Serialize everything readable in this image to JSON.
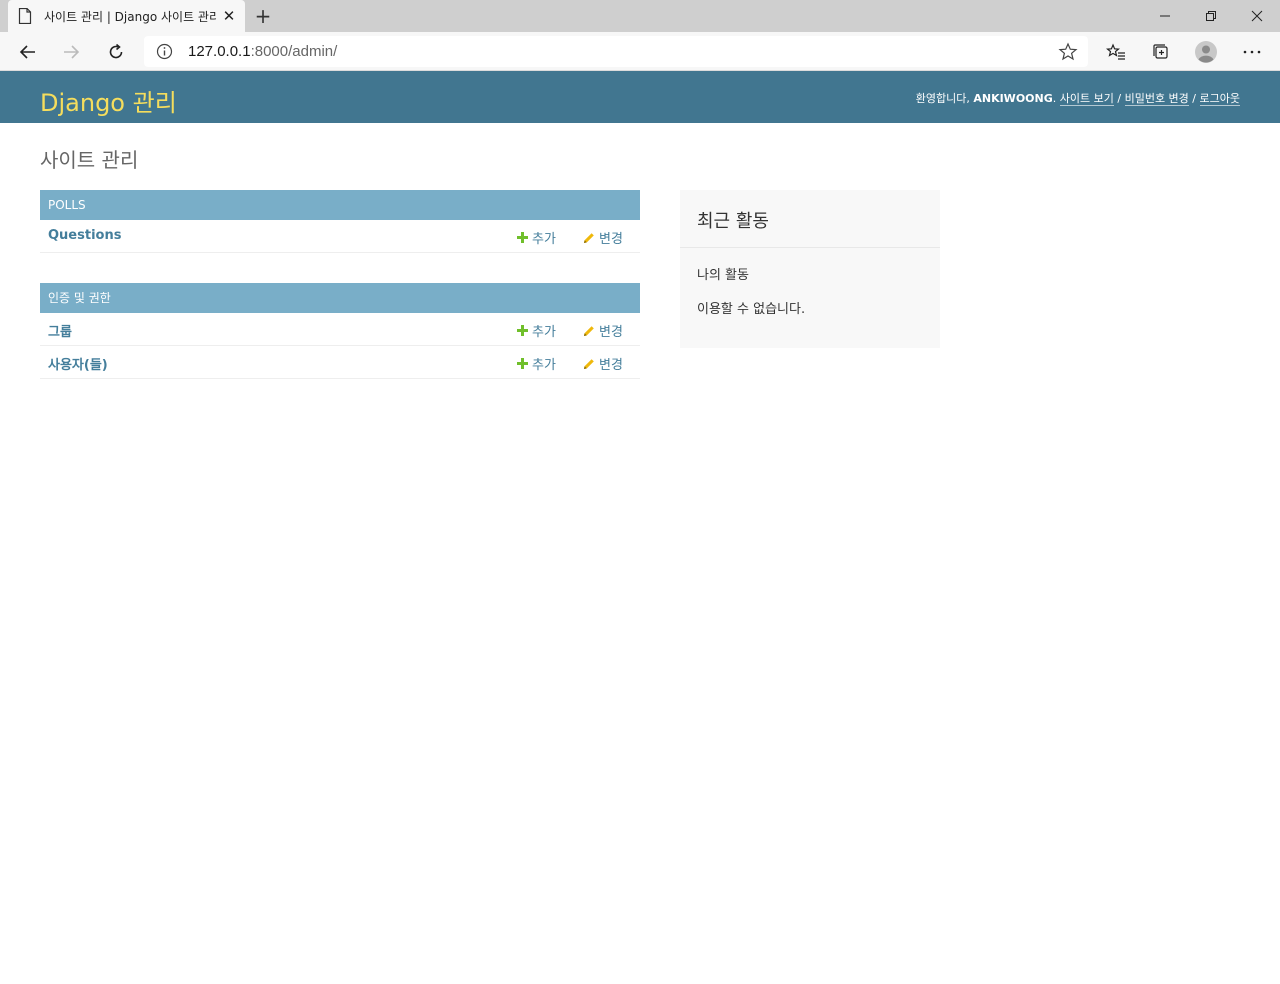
{
  "browser": {
    "tab_title": "사이트 관리 | Django 사이트 관리",
    "url_host": "127.0.0.1",
    "url_rest": ":8000/admin/"
  },
  "header": {
    "brand": "Django 관리",
    "welcome": "환영합니다,",
    "username": "ANKIWOONG",
    "view_site": "사이트 보기",
    "change_password": "비밀번호 변경",
    "logout": "로그아웃",
    "separator": "/"
  },
  "page_title": "사이트 관리",
  "modules": [
    {
      "caption": "POLLS",
      "models": [
        {
          "name": "Questions",
          "add": "추가",
          "change": "변경"
        }
      ]
    },
    {
      "caption": "인증 및 권한",
      "models": [
        {
          "name": "그룹",
          "add": "추가",
          "change": "변경"
        },
        {
          "name": "사용자(들)",
          "add": "추가",
          "change": "변경"
        }
      ]
    }
  ],
  "recent_actions": {
    "title": "최근 활동",
    "subtitle": "나의 활동",
    "empty": "이용할 수 없습니다."
  },
  "colors": {
    "header_bg": "#417690",
    "brand": "#f5dd5d",
    "caption_bg": "#79aec8",
    "link": "#447e9b",
    "add_icon": "#70bf2b",
    "change_icon": "#efb80b"
  }
}
